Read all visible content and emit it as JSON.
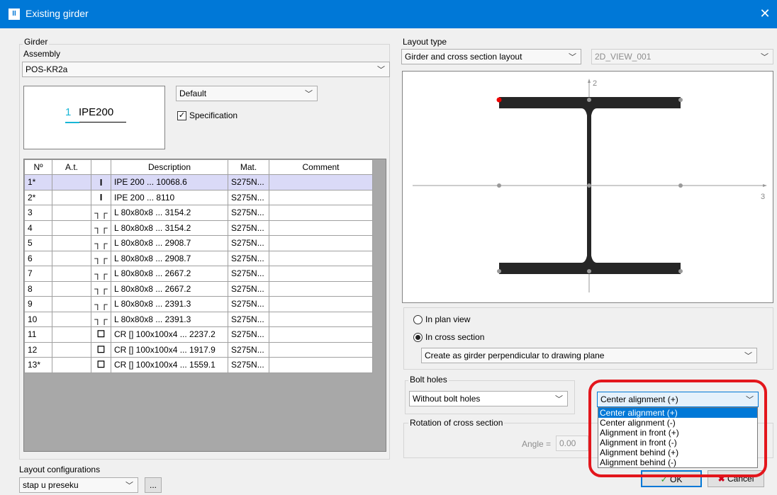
{
  "window": {
    "title": "Existing girder",
    "app_icon": "II",
    "close_glyph": "✕"
  },
  "girder": {
    "group_label": "Girder",
    "assembly_label": "Assembly",
    "assembly_value": "POS-KR2a",
    "preview_number": "1",
    "preview_profile": "IPE200",
    "style_value": "Default",
    "specification_label": "Specification",
    "specification_checked": true
  },
  "table": {
    "columns": [
      "Nº",
      "A.t.",
      "",
      "Description",
      "Mat.",
      "Comment"
    ],
    "rows": [
      {
        "no": "1*",
        "at": "",
        "icon": "I",
        "desc": "IPE 200 ... 10068.6",
        "mat": "S275N...",
        "comment": "",
        "selected": true
      },
      {
        "no": "2*",
        "at": "",
        "icon": "I",
        "desc": "IPE 200 ... 8110",
        "mat": "S275N...",
        "comment": ""
      },
      {
        "no": "3",
        "at": "",
        "icon": "┐┌",
        "desc": "L 80x80x8 ... 3154.2",
        "mat": "S275N...",
        "comment": ""
      },
      {
        "no": "4",
        "at": "",
        "icon": "┐┌",
        "desc": "L 80x80x8 ... 3154.2",
        "mat": "S275N...",
        "comment": ""
      },
      {
        "no": "5",
        "at": "",
        "icon": "┐┌",
        "desc": "L 80x80x8 ... 2908.7",
        "mat": "S275N...",
        "comment": ""
      },
      {
        "no": "6",
        "at": "",
        "icon": "┐┌",
        "desc": "L 80x80x8 ... 2908.7",
        "mat": "S275N...",
        "comment": ""
      },
      {
        "no": "7",
        "at": "",
        "icon": "┐┌",
        "desc": "L 80x80x8 ... 2667.2",
        "mat": "S275N...",
        "comment": ""
      },
      {
        "no": "8",
        "at": "",
        "icon": "┐┌",
        "desc": "L 80x80x8 ... 2667.2",
        "mat": "S275N...",
        "comment": ""
      },
      {
        "no": "9",
        "at": "",
        "icon": "┐┌",
        "desc": "L 80x80x8 ... 2391.3",
        "mat": "S275N...",
        "comment": ""
      },
      {
        "no": "10",
        "at": "",
        "icon": "┐┌",
        "desc": "L 80x80x8 ... 2391.3",
        "mat": "S275N...",
        "comment": ""
      },
      {
        "no": "11",
        "at": "",
        "icon": "☐",
        "desc": "CR [] 100x100x4 ... 2237.2",
        "mat": "S275N...",
        "comment": ""
      },
      {
        "no": "12",
        "at": "",
        "icon": "☐",
        "desc": "CR [] 100x100x4 ... 1917.9",
        "mat": "S275N...",
        "comment": ""
      },
      {
        "no": "13*",
        "at": "",
        "icon": "☐",
        "desc": "CR [] 100x100x4 ... 1559.1",
        "mat": "S275N...",
        "comment": ""
      }
    ]
  },
  "layout_configs": {
    "label": "Layout configurations",
    "value": "stap u preseku",
    "more_button": "..."
  },
  "layout_type": {
    "label": "Layout type",
    "value": "Girder and cross section layout",
    "view_value": "2D_VIEW_001",
    "axis_y_label": "2",
    "axis_x_label": "3"
  },
  "placement": {
    "plan_view_label": "In plan view",
    "cross_section_label": "In cross section",
    "selected": "cross_section",
    "create_value": "Create as girder perpendicular to drawing plane"
  },
  "bolt_holes": {
    "label": "Bolt holes",
    "value": "Without bolt holes"
  },
  "alignment": {
    "value": "Center alignment (+)",
    "options": [
      "Center alignment (+)",
      "Center alignment (-)",
      "Alignment in front (+)",
      "Alignment in front (-)",
      "Alignment behind (+)",
      "Alignment behind (-)"
    ],
    "highlighted_index": 0
  },
  "rotation": {
    "label": "Rotation of cross section",
    "angle_label": "Angle =",
    "angle_value": "0.00"
  },
  "buttons": {
    "ok": "OK",
    "cancel": "Cancel"
  },
  "colors": {
    "titlebar": "#0078d7",
    "highlight": "#0078d7",
    "annotation": "#e3161c",
    "selected_row": "#dadaf7"
  }
}
